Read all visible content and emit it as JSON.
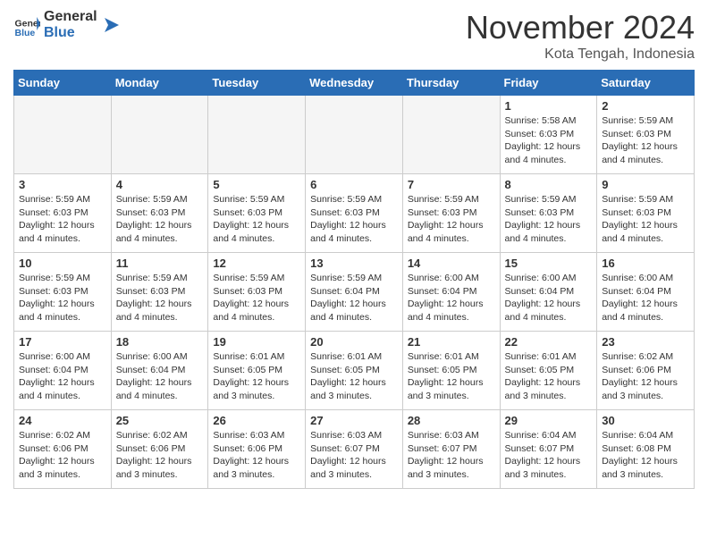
{
  "header": {
    "logo_general": "General",
    "logo_blue": "Blue",
    "month_year": "November 2024",
    "location": "Kota Tengah, Indonesia"
  },
  "weekdays": [
    "Sunday",
    "Monday",
    "Tuesday",
    "Wednesday",
    "Thursday",
    "Friday",
    "Saturday"
  ],
  "weeks": [
    [
      {
        "day": "",
        "info": ""
      },
      {
        "day": "",
        "info": ""
      },
      {
        "day": "",
        "info": ""
      },
      {
        "day": "",
        "info": ""
      },
      {
        "day": "",
        "info": ""
      },
      {
        "day": "1",
        "info": "Sunrise: 5:58 AM\nSunset: 6:03 PM\nDaylight: 12 hours and 4 minutes."
      },
      {
        "day": "2",
        "info": "Sunrise: 5:59 AM\nSunset: 6:03 PM\nDaylight: 12 hours and 4 minutes."
      }
    ],
    [
      {
        "day": "3",
        "info": "Sunrise: 5:59 AM\nSunset: 6:03 PM\nDaylight: 12 hours and 4 minutes."
      },
      {
        "day": "4",
        "info": "Sunrise: 5:59 AM\nSunset: 6:03 PM\nDaylight: 12 hours and 4 minutes."
      },
      {
        "day": "5",
        "info": "Sunrise: 5:59 AM\nSunset: 6:03 PM\nDaylight: 12 hours and 4 minutes."
      },
      {
        "day": "6",
        "info": "Sunrise: 5:59 AM\nSunset: 6:03 PM\nDaylight: 12 hours and 4 minutes."
      },
      {
        "day": "7",
        "info": "Sunrise: 5:59 AM\nSunset: 6:03 PM\nDaylight: 12 hours and 4 minutes."
      },
      {
        "day": "8",
        "info": "Sunrise: 5:59 AM\nSunset: 6:03 PM\nDaylight: 12 hours and 4 minutes."
      },
      {
        "day": "9",
        "info": "Sunrise: 5:59 AM\nSunset: 6:03 PM\nDaylight: 12 hours and 4 minutes."
      }
    ],
    [
      {
        "day": "10",
        "info": "Sunrise: 5:59 AM\nSunset: 6:03 PM\nDaylight: 12 hours and 4 minutes."
      },
      {
        "day": "11",
        "info": "Sunrise: 5:59 AM\nSunset: 6:03 PM\nDaylight: 12 hours and 4 minutes."
      },
      {
        "day": "12",
        "info": "Sunrise: 5:59 AM\nSunset: 6:03 PM\nDaylight: 12 hours and 4 minutes."
      },
      {
        "day": "13",
        "info": "Sunrise: 5:59 AM\nSunset: 6:04 PM\nDaylight: 12 hours and 4 minutes."
      },
      {
        "day": "14",
        "info": "Sunrise: 6:00 AM\nSunset: 6:04 PM\nDaylight: 12 hours and 4 minutes."
      },
      {
        "day": "15",
        "info": "Sunrise: 6:00 AM\nSunset: 6:04 PM\nDaylight: 12 hours and 4 minutes."
      },
      {
        "day": "16",
        "info": "Sunrise: 6:00 AM\nSunset: 6:04 PM\nDaylight: 12 hours and 4 minutes."
      }
    ],
    [
      {
        "day": "17",
        "info": "Sunrise: 6:00 AM\nSunset: 6:04 PM\nDaylight: 12 hours and 4 minutes."
      },
      {
        "day": "18",
        "info": "Sunrise: 6:00 AM\nSunset: 6:04 PM\nDaylight: 12 hours and 4 minutes."
      },
      {
        "day": "19",
        "info": "Sunrise: 6:01 AM\nSunset: 6:05 PM\nDaylight: 12 hours and 3 minutes."
      },
      {
        "day": "20",
        "info": "Sunrise: 6:01 AM\nSunset: 6:05 PM\nDaylight: 12 hours and 3 minutes."
      },
      {
        "day": "21",
        "info": "Sunrise: 6:01 AM\nSunset: 6:05 PM\nDaylight: 12 hours and 3 minutes."
      },
      {
        "day": "22",
        "info": "Sunrise: 6:01 AM\nSunset: 6:05 PM\nDaylight: 12 hours and 3 minutes."
      },
      {
        "day": "23",
        "info": "Sunrise: 6:02 AM\nSunset: 6:06 PM\nDaylight: 12 hours and 3 minutes."
      }
    ],
    [
      {
        "day": "24",
        "info": "Sunrise: 6:02 AM\nSunset: 6:06 PM\nDaylight: 12 hours and 3 minutes."
      },
      {
        "day": "25",
        "info": "Sunrise: 6:02 AM\nSunset: 6:06 PM\nDaylight: 12 hours and 3 minutes."
      },
      {
        "day": "26",
        "info": "Sunrise: 6:03 AM\nSunset: 6:06 PM\nDaylight: 12 hours and 3 minutes."
      },
      {
        "day": "27",
        "info": "Sunrise: 6:03 AM\nSunset: 6:07 PM\nDaylight: 12 hours and 3 minutes."
      },
      {
        "day": "28",
        "info": "Sunrise: 6:03 AM\nSunset: 6:07 PM\nDaylight: 12 hours and 3 minutes."
      },
      {
        "day": "29",
        "info": "Sunrise: 6:04 AM\nSunset: 6:07 PM\nDaylight: 12 hours and 3 minutes."
      },
      {
        "day": "30",
        "info": "Sunrise: 6:04 AM\nSunset: 6:08 PM\nDaylight: 12 hours and 3 minutes."
      }
    ]
  ]
}
